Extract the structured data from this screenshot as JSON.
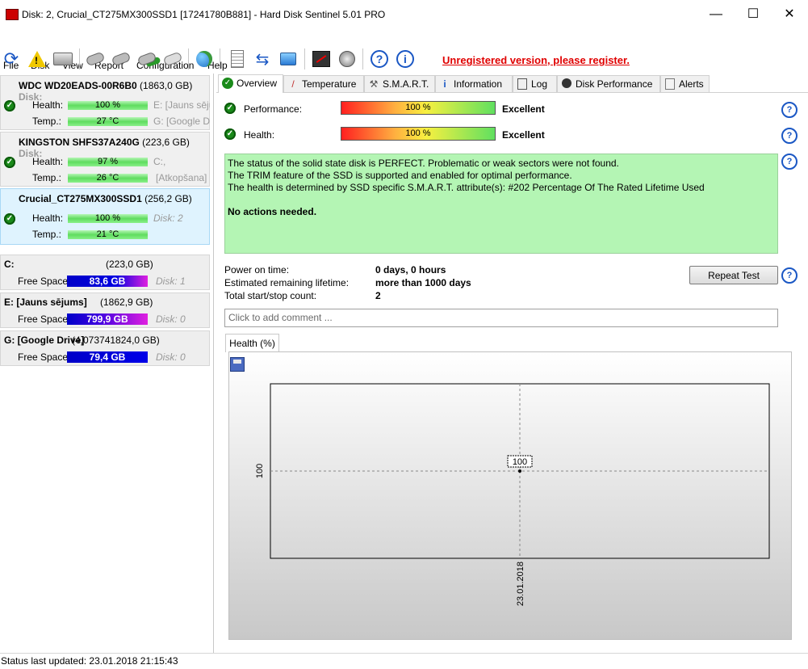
{
  "window": {
    "title": "Disk: 2, Crucial_CT275MX300SSD1 [17241780B881]  -  Hard Disk Sentinel 5.01 PRO",
    "minimize": "—",
    "maximize": "☐",
    "close": "✕"
  },
  "menu": [
    "File",
    "Disk",
    "View",
    "Report",
    "Configuration",
    "Help"
  ],
  "toolbar": {
    "icons": [
      "refresh-icon",
      "alert-icon",
      "disk-icon",
      "disk-tools-icon",
      "disk-check-icon",
      "disk-ok-icon",
      "disk-search-icon",
      "globe-icon",
      "report-icon",
      "sync-icon",
      "network-icon",
      "stats-icon",
      "sound-icon",
      "help-icon",
      "info-icon"
    ],
    "unregistered_text": "Unregistered version, please register."
  },
  "disks": [
    {
      "name": "WDC WD20EADS-00R6B0",
      "size": "(1863,0 GB)",
      "extra": "Disk:",
      "health_label": "Health:",
      "health": "100 %",
      "health_fill": 1.0,
      "temp_label": "Temp.:",
      "temp": "27 °C",
      "right1": "E: [Jauns sējum",
      "right2": "G: [Google Dr"
    },
    {
      "name": "KINGSTON SHFS37A240G",
      "size": "(223,6 GB)",
      "extra": "Disk:",
      "health_label": "Health:",
      "health": "97 %",
      "health_fill": 0.97,
      "temp_label": "Temp.:",
      "temp": "26 °C",
      "right1": "C:,",
      "right2": "[Atkopšana]"
    },
    {
      "name": "Crucial_CT275MX300SSD1",
      "size": "(256,2 GB)",
      "extra": "",
      "health_label": "Health:",
      "health": "100 %",
      "health_fill": 1.0,
      "temp_label": "Temp.:",
      "temp": "21 °C",
      "right1": "Disk: 2",
      "right2": ""
    }
  ],
  "volumes": [
    {
      "name": "C:",
      "size": "(223,0 GB)",
      "free_label": "Free Space",
      "free": "83,6 GB",
      "disk": "Disk: 1"
    },
    {
      "name": "E: [Jauns sējums]",
      "size": "(1862,9 GB)",
      "free_label": "Free Space",
      "free": "799,9 GB",
      "disk": "Disk: 0"
    },
    {
      "name": "G: [Google Drive]",
      "size": "(4,073741824,0 GB)",
      "free_label": "Free Space",
      "free": "79,4 GB",
      "disk": "Disk: 0"
    }
  ],
  "tabs": [
    "Overview",
    "Temperature",
    "S.M.A.R.T.",
    "Information",
    "Log",
    "Disk Performance",
    "Alerts"
  ],
  "overview": {
    "performance_label": "Performance:",
    "performance_value": "100 %",
    "performance_text": "Excellent",
    "health_label": "Health:",
    "health_value": "100 %",
    "health_text": "Excellent",
    "status_lines": [
      "The status of the solid state disk is PERFECT. Problematic or weak sectors were not found.",
      "The TRIM feature of the SSD is supported and enabled for optimal performance.",
      "The health is determined by SSD specific S.M.A.R.T. attribute(s):  #202 Percentage Of The Rated Lifetime Used"
    ],
    "no_actions": "No actions needed.",
    "power_on_label": "Power on time:",
    "power_on_value": "0 days, 0 hours",
    "lifetime_label": "Estimated remaining lifetime:",
    "lifetime_value": "more than 1000 days",
    "startstop_label": "Total start/stop count:",
    "startstop_value": "2",
    "repeat_test": "Repeat Test",
    "comment_placeholder": "Click to add comment ...",
    "health_tab": "Health (%)"
  },
  "chart_data": {
    "type": "line",
    "series": [
      {
        "values": [
          100
        ]
      }
    ],
    "x": [
      "23.01.2018"
    ],
    "ylabel": "",
    "ytick": "100",
    "data_label": "100",
    "grid": true
  },
  "status_bar": "Status last updated: 23.01.2018 21:15:43",
  "colors": {
    "unregistered": "#e00000",
    "status_ok_bg": "#b4f5b4",
    "selected_disk_bg": "#dff3fe",
    "free_bar": "#0000e0"
  }
}
